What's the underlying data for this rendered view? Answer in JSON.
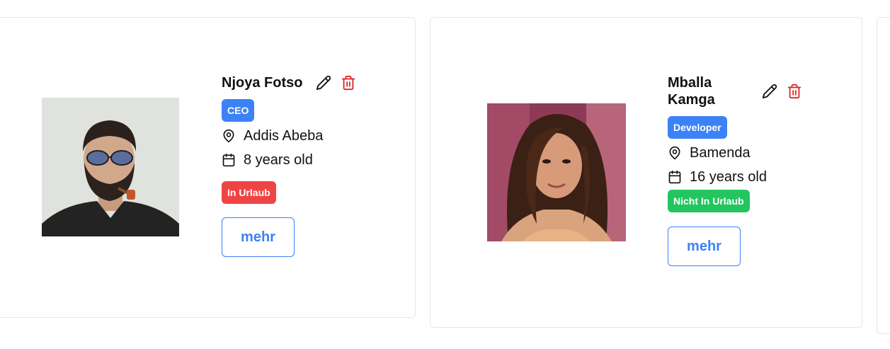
{
  "colors": {
    "accent": "#3b82f6",
    "danger": "#ef4444",
    "success": "#22c55e",
    "delete_icon": "#dc2626",
    "card_border": "#e5e7eb"
  },
  "employees": [
    {
      "name": "Njoya Fotso",
      "role": "CEO",
      "role_color": "blue",
      "location": "Addis Abeba",
      "age": "8 years old",
      "status": "In Urlaub",
      "status_color": "red",
      "more_label": "mehr",
      "photo_icon": "portrait-photo",
      "edit_icon": "pencil-icon",
      "delete_icon": "trash-icon"
    },
    {
      "name": "Mballa Kamga",
      "role": "Developer",
      "role_color": "blue",
      "location": "Bamenda",
      "age": "16 years old",
      "status": "Nicht In Urlaub",
      "status_color": "green",
      "more_label": "mehr",
      "photo_icon": "portrait-photo",
      "edit_icon": "pencil-icon",
      "delete_icon": "trash-icon"
    }
  ]
}
